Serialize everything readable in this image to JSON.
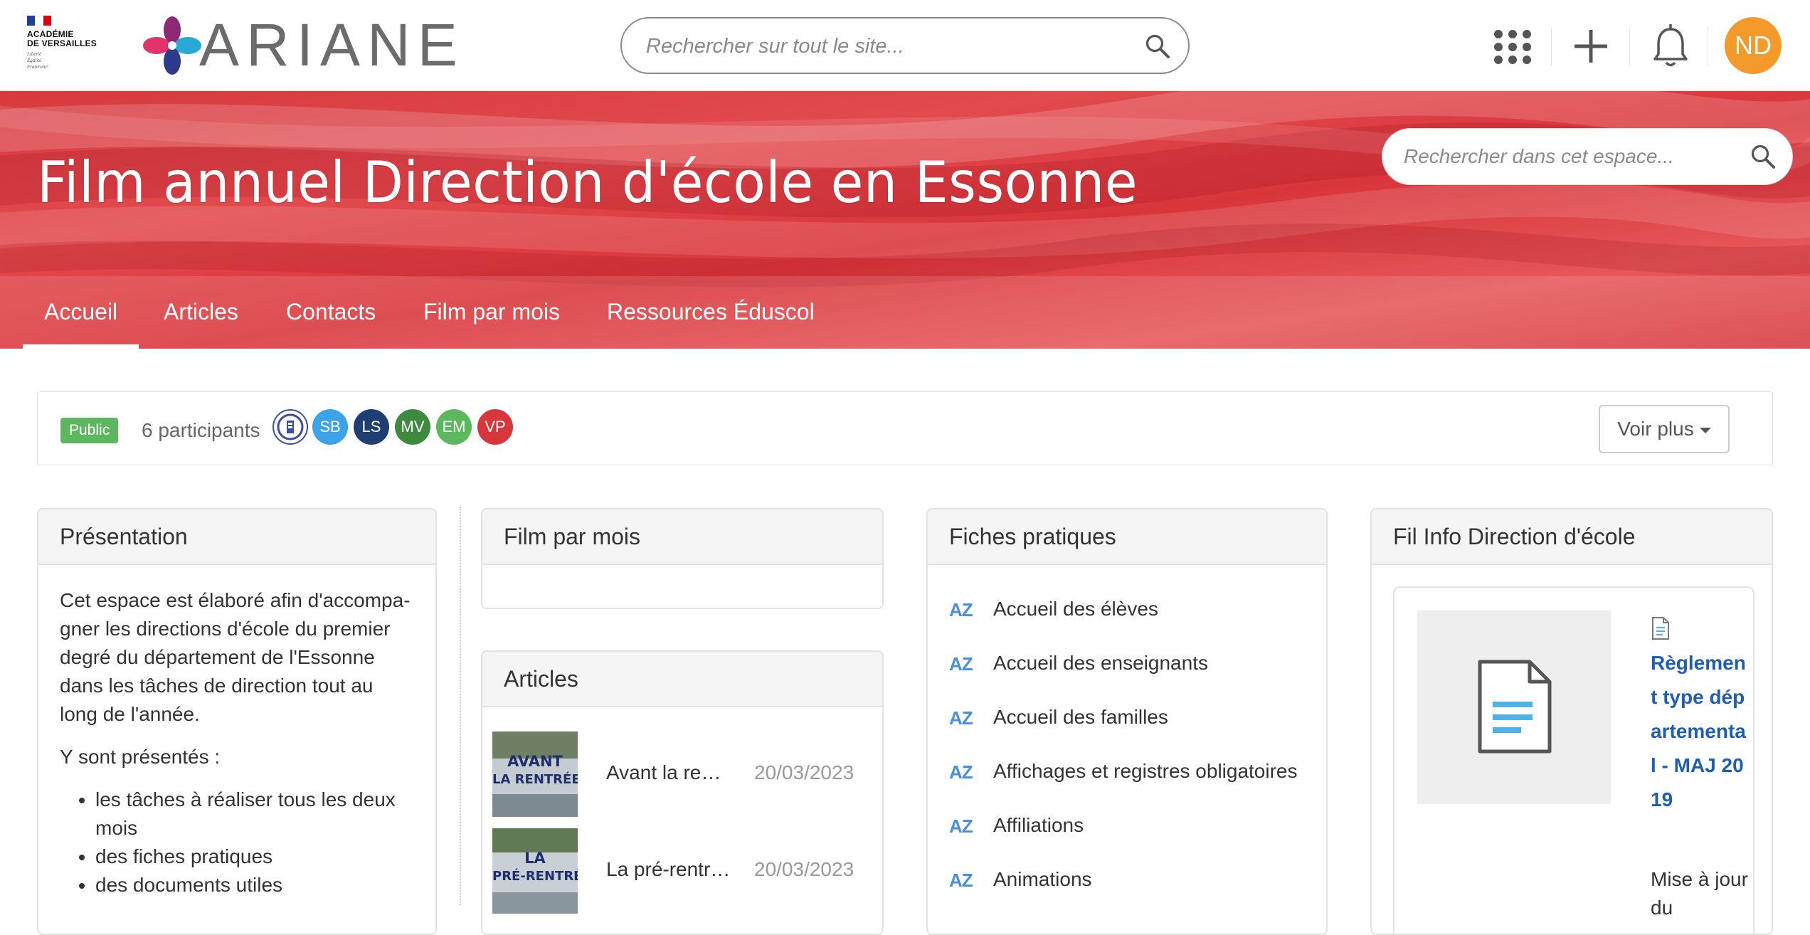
{
  "header": {
    "academie_line1": "ACADÉMIE",
    "academie_line2": "DE VERSAILLES",
    "academie_motto": "Liberté Égalité Fraternité",
    "app_name": "ARIANE",
    "search_placeholder": "Rechercher sur tout le site...",
    "user_initials": "ND",
    "colors": {
      "avatar": "#f39a2a",
      "brand_red": "#d9363b"
    }
  },
  "space": {
    "title": "Film annuel Direction d'école en Essonne",
    "search_placeholder": "Rechercher dans cet espace...",
    "tabs": [
      {
        "label": "Accueil",
        "active": true
      },
      {
        "label": "Articles",
        "active": false
      },
      {
        "label": "Contacts",
        "active": false
      },
      {
        "label": "Film par mois",
        "active": false
      },
      {
        "label": "Ressources Éduscol",
        "active": false
      }
    ]
  },
  "participants": {
    "visibility_badge": "Public",
    "count_label": "6 participants",
    "avatars": [
      {
        "initials": "",
        "color": "#ffffff",
        "icon": "institution-logo-icon"
      },
      {
        "initials": "SB",
        "color": "#3ba3e8"
      },
      {
        "initials": "LS",
        "color": "#1f3f73"
      },
      {
        "initials": "MV",
        "color": "#3e8a3e"
      },
      {
        "initials": "EM",
        "color": "#5cb85c"
      },
      {
        "initials": "VP",
        "color": "#d9363b"
      }
    ],
    "more_button": "Voir plus"
  },
  "presentation": {
    "heading": "Présentation",
    "paragraph1": "Cet espace est élaboré afin d'accompa-gner les directions d'école du premier degré du département de l'Essonne dans les tâches de direction tout au long de l'année.",
    "paragraph2": "Y sont présentés :",
    "bullets": [
      "les tâches à réaliser tous les deux mois",
      "des fiches pratiques",
      "des documents utiles"
    ]
  },
  "film_par_mois": {
    "heading": "Film par mois"
  },
  "articles": {
    "heading": "Articles",
    "items": [
      {
        "title": "Avant la rent…",
        "date": "20/03/2023",
        "thumb_line1": "AVANT",
        "thumb_line2": "LA RENTRÉE"
      },
      {
        "title": "La pré-rentrée",
        "date": "20/03/2023",
        "thumb_line1": "LA",
        "thumb_line2": "PRÉ-RENTRÉE"
      }
    ]
  },
  "fiches": {
    "heading": "Fiches pratiques",
    "az_label": "AZ",
    "items": [
      "Accueil des élèves",
      "Accueil des enseignants",
      "Accueil des familles",
      "Affichages et registres obligatoires",
      "Affiliations",
      "Animations"
    ]
  },
  "fil_info": {
    "heading": "Fil Info Direction d'école",
    "card_title": "Règlement type départemental - MAJ 2019",
    "card_desc": "Mise à jour du"
  }
}
